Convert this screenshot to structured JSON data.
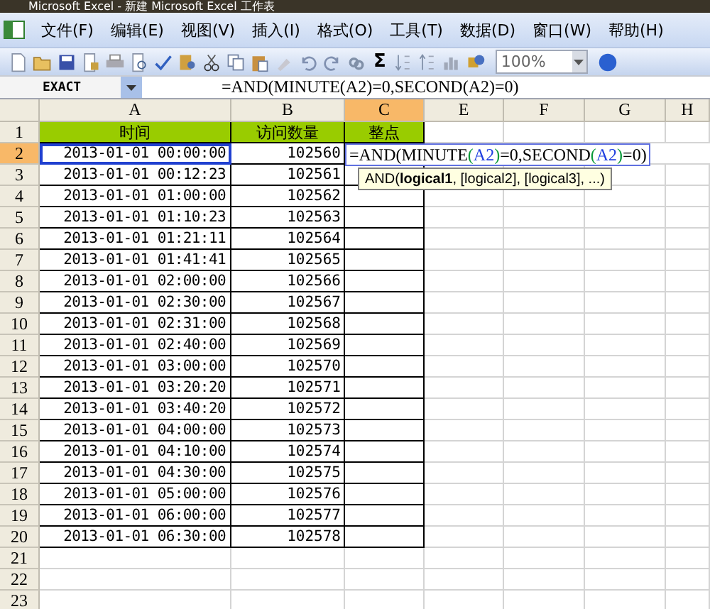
{
  "window": {
    "title": "Microsoft Excel - 新建 Microsoft Excel 工作表"
  },
  "menu": [
    {
      "label": "文件(F)"
    },
    {
      "label": "编辑(E)"
    },
    {
      "label": "视图(V)"
    },
    {
      "label": "插入(I)"
    },
    {
      "label": "格式(O)"
    },
    {
      "label": "工具(T)"
    },
    {
      "label": "数据(D)"
    },
    {
      "label": "窗口(W)"
    },
    {
      "label": "帮助(H)"
    }
  ],
  "toolbar": {
    "sum": "Σ",
    "zoom": "100%"
  },
  "formula_bar": {
    "name_box": "EXACT",
    "formula": "=AND(MINUTE(A2)=0,SECOND(A2)=0)"
  },
  "columns": [
    {
      "label": "A",
      "selected": false
    },
    {
      "label": "B",
      "selected": false
    },
    {
      "label": "C",
      "selected": true
    },
    {
      "label": "E",
      "selected": false
    },
    {
      "label": "F",
      "selected": false
    },
    {
      "label": "G",
      "selected": false
    },
    {
      "label": "H",
      "selected": false
    }
  ],
  "header_row": {
    "number": "1",
    "cells": [
      "时间",
      "访问数量",
      "整点"
    ]
  },
  "rows": [
    {
      "number": "2",
      "selected": true,
      "time": "2013-01-01 00:00:00",
      "count": "102560"
    },
    {
      "number": "3",
      "selected": false,
      "time": "2013-01-01 00:12:23",
      "count": "102561"
    },
    {
      "number": "4",
      "selected": false,
      "time": "2013-01-01 01:00:00",
      "count": "102562"
    },
    {
      "number": "5",
      "selected": false,
      "time": "2013-01-01 01:10:23",
      "count": "102563"
    },
    {
      "number": "6",
      "selected": false,
      "time": "2013-01-01 01:21:11",
      "count": "102564"
    },
    {
      "number": "7",
      "selected": false,
      "time": "2013-01-01 01:41:41",
      "count": "102565"
    },
    {
      "number": "8",
      "selected": false,
      "time": "2013-01-01 02:00:00",
      "count": "102566"
    },
    {
      "number": "9",
      "selected": false,
      "time": "2013-01-01 02:30:00",
      "count": "102567"
    },
    {
      "number": "10",
      "selected": false,
      "time": "2013-01-01 02:31:00",
      "count": "102568"
    },
    {
      "number": "11",
      "selected": false,
      "time": "2013-01-01 02:40:00",
      "count": "102569"
    },
    {
      "number": "12",
      "selected": false,
      "time": "2013-01-01 03:00:00",
      "count": "102570"
    },
    {
      "number": "13",
      "selected": false,
      "time": "2013-01-01 03:20:20",
      "count": "102571"
    },
    {
      "number": "14",
      "selected": false,
      "time": "2013-01-01 03:40:20",
      "count": "102572"
    },
    {
      "number": "15",
      "selected": false,
      "time": "2013-01-01 04:00:00",
      "count": "102573"
    },
    {
      "number": "16",
      "selected": false,
      "time": "2013-01-01 04:10:00",
      "count": "102574"
    },
    {
      "number": "17",
      "selected": false,
      "time": "2013-01-01 04:30:00",
      "count": "102575"
    },
    {
      "number": "18",
      "selected": false,
      "time": "2013-01-01 05:00:00",
      "count": "102576"
    },
    {
      "number": "19",
      "selected": false,
      "time": "2013-01-01 06:00:00",
      "count": "102577"
    },
    {
      "number": "20",
      "selected": false,
      "time": "2013-01-01 06:30:00",
      "count": "102578"
    }
  ],
  "empty_rows": [
    {
      "number": "21"
    },
    {
      "number": "22"
    },
    {
      "number": "23"
    }
  ],
  "cell_editor": {
    "segments": [
      {
        "text": "=AND(MINUTE",
        "color": "#000000"
      },
      {
        "text": "(",
        "color": "#0a9a3a"
      },
      {
        "text": "A2",
        "color": "#1f3fe0"
      },
      {
        "text": ")",
        "color": "#0a9a3a"
      },
      {
        "text": "=0,SECOND",
        "color": "#000000"
      },
      {
        "text": "(",
        "color": "#0a9a3a"
      },
      {
        "text": "A2",
        "color": "#1f3fe0"
      },
      {
        "text": ")",
        "color": "#0a9a3a"
      },
      {
        "text": "=0)",
        "color": "#000000"
      }
    ]
  },
  "tooltip": {
    "text": "AND(**logical1**, [logical2], [logical3], ...)"
  }
}
